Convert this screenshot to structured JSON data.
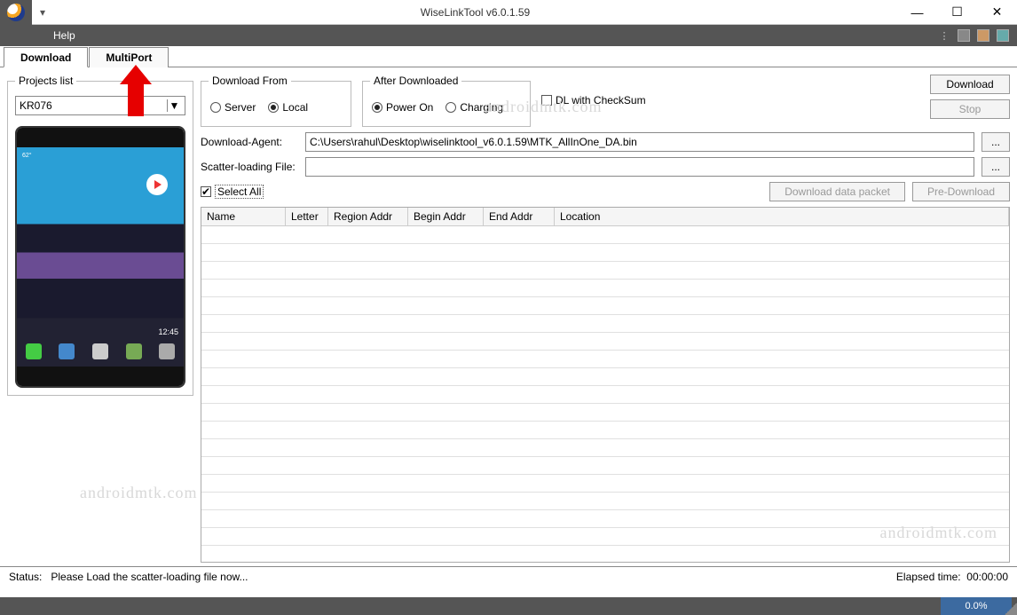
{
  "window": {
    "title": "WiseLinkTool v6.0.1.59"
  },
  "menu": {
    "help": "Help"
  },
  "tabs": {
    "download": "Download",
    "multiport": "MultiPort"
  },
  "projects": {
    "legend": "Projects list",
    "selected": "KR076"
  },
  "download_from": {
    "legend": "Download From",
    "server": "Server",
    "local": "Local",
    "selected": "local"
  },
  "after_downloaded": {
    "legend": "After Downloaded",
    "power_on": "Power On",
    "charging": "Charging",
    "selected": "power_on"
  },
  "dl_checksum": {
    "label": "DL with CheckSum",
    "checked": false
  },
  "buttons": {
    "download": "Download",
    "stop": "Stop",
    "browse": "...",
    "download_data_packet": "Download data packet",
    "pre_download": "Pre-Download"
  },
  "fields": {
    "download_agent_label": "Download-Agent:",
    "download_agent_value": "C:\\Users\\rahul\\Desktop\\wiselinktool_v6.0.1.59\\MTK_AllInOne_DA.bin",
    "scatter_label": "Scatter-loading File:",
    "scatter_value": ""
  },
  "select_all": {
    "label": "Select All",
    "checked": true
  },
  "table": {
    "columns": {
      "name": "Name",
      "letter": "Letter",
      "region": "Region Addr",
      "begin": "Begin Addr",
      "end": "End Addr",
      "location": "Location"
    }
  },
  "status": {
    "prefix": "Status:",
    "message": "Please Load the scatter-loading file now...",
    "elapsed_label": "Elapsed time:",
    "elapsed_value": "00:00:00"
  },
  "progress": {
    "percent": "0.0%"
  },
  "watermark": "androidmtk.com"
}
